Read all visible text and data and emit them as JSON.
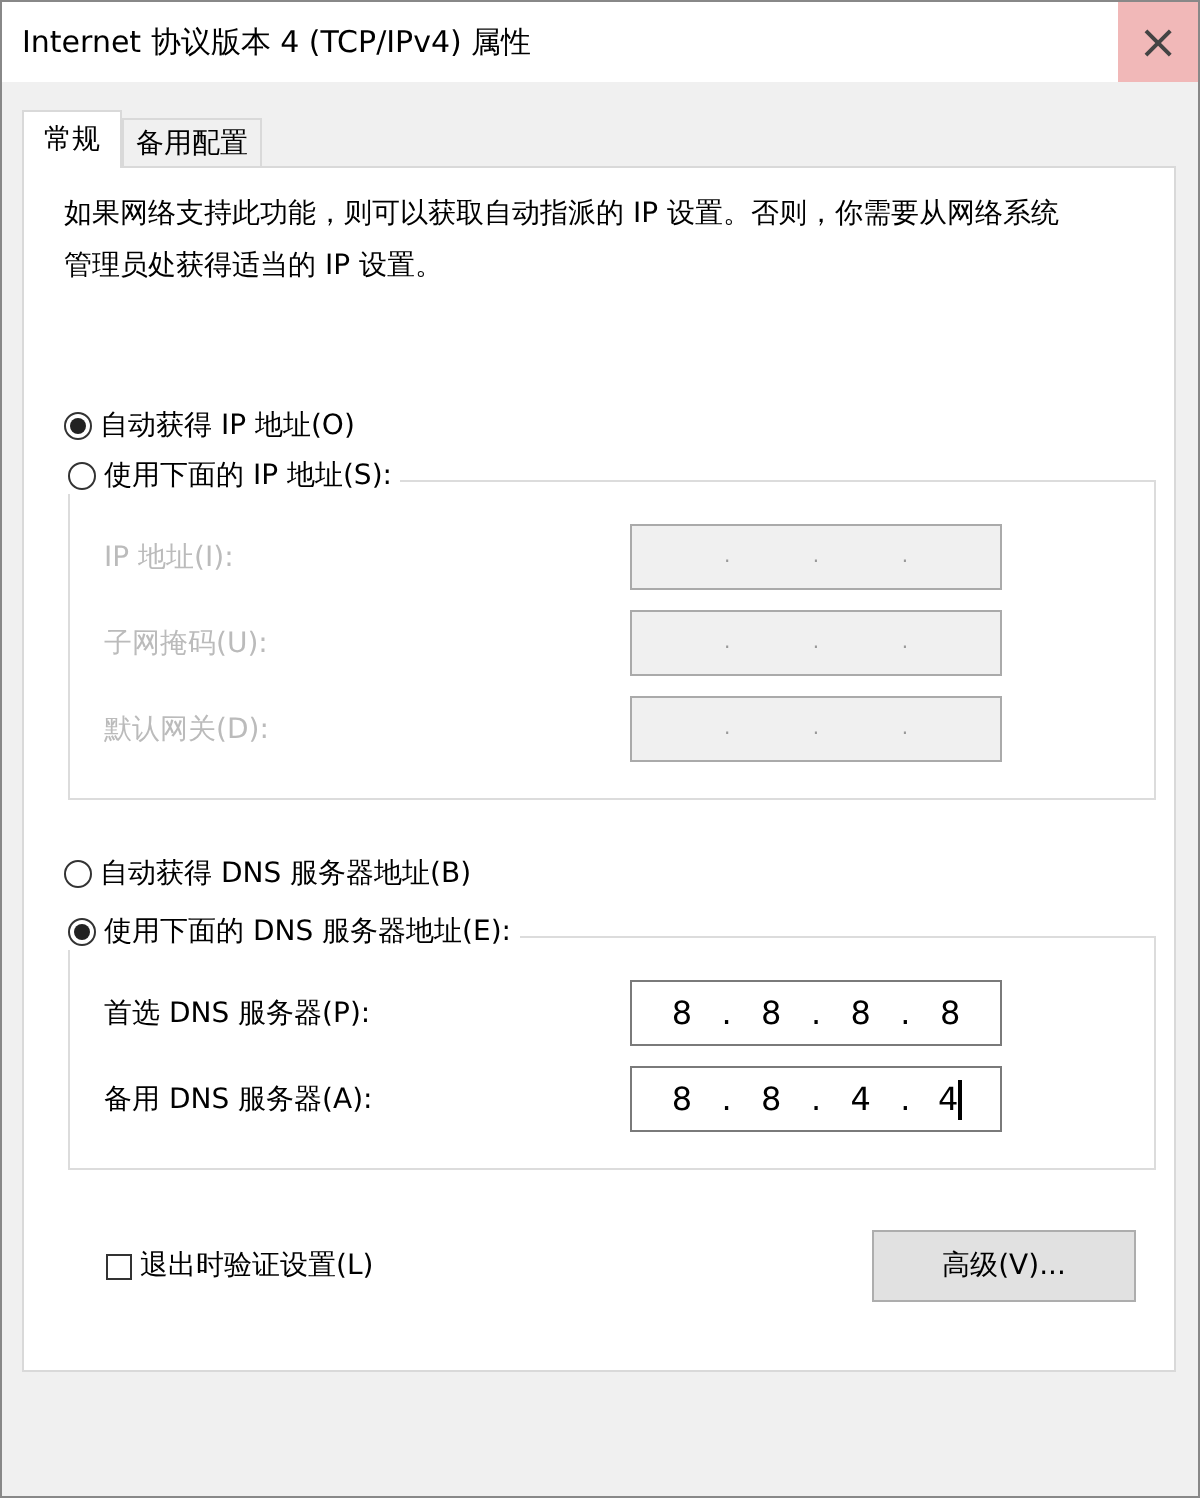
{
  "window": {
    "title": "Internet 协议版本 4 (TCP/IPv4) 属性",
    "close": "×"
  },
  "tabs": [
    {
      "label": "常规",
      "selected": true
    },
    {
      "label": "备用配置",
      "selected": false
    }
  ],
  "description": "如果网络支持此功能，则可以获取自动指派的 IP 设置。否则，你需要从网络系统管理员处获得适当的 IP 设置。",
  "ip_modes": [
    {
      "label": "自动获得 IP 地址(O)",
      "selected": true
    },
    {
      "label": "使用下面的 IP 地址(S):",
      "selected": false
    }
  ],
  "ip_fields": [
    {
      "label": "IP 地址(I):",
      "separator": ".",
      "disabled": true,
      "focused": false
    },
    {
      "label": "子网掩码(U):",
      "separator": ".",
      "disabled": true,
      "focused": false
    },
    {
      "label": "默认网关(D):",
      "separator": ".",
      "disabled": true,
      "focused": false
    }
  ],
  "dns_modes": [
    {
      "label": "自动获得 DNS 服务器地址(B)",
      "selected": false
    },
    {
      "label": "使用下面的 DNS 服务器地址(E):",
      "selected": true
    }
  ],
  "dns_fields": [
    {
      "label": "首选 DNS 服务器(P):",
      "separator": ".",
      "octets": [
        "8",
        "8",
        "8",
        "8"
      ],
      "disabled": false,
      "focused": false
    },
    {
      "label": "备用 DNS 服务器(A):",
      "separator": ".",
      "octets": [
        "8",
        "8",
        "4",
        "4"
      ],
      "disabled": false,
      "focused": true
    }
  ],
  "validate_on_exit": {
    "label": "退出时验证设置(L)",
    "checked": false
  },
  "advanced_button": "高级(V)..."
}
